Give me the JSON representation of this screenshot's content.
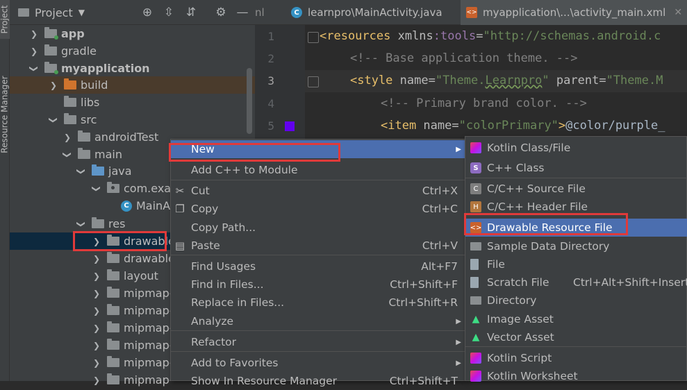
{
  "toolstrip": {
    "project_tab": "Project",
    "resource_manager_tab": "Resource Manager"
  },
  "project_panel": {
    "title": "Project",
    "toolbar_icons": [
      "locate-icon",
      "expand-all-icon",
      "collapse-all-icon",
      "gear-icon",
      "minimize-icon"
    ]
  },
  "tree": [
    {
      "label": "app",
      "bold": true,
      "arrow": "right",
      "icon": "module-folder"
    },
    {
      "label": "gradle",
      "arrow": "right",
      "icon": "folder"
    },
    {
      "label": "myapplication",
      "bold": true,
      "arrow": "down",
      "icon": "module-folder"
    },
    {
      "label": "build",
      "arrow": "right",
      "icon": "excluded-folder"
    },
    {
      "label": "libs",
      "arrow": "",
      "icon": "folder"
    },
    {
      "label": "src",
      "arrow": "down",
      "icon": "folder"
    },
    {
      "label": "androidTest",
      "arrow": "right",
      "icon": "folder"
    },
    {
      "label": "main",
      "arrow": "down",
      "icon": "folder"
    },
    {
      "label": "java",
      "arrow": "down",
      "icon": "source-folder"
    },
    {
      "label": "com.exa",
      "arrow": "down",
      "icon": "package"
    },
    {
      "label": "MainA",
      "arrow": "",
      "icon": "class"
    },
    {
      "label": "res",
      "arrow": "down",
      "icon": "resource-folder"
    },
    {
      "label": "drawable",
      "arrow": "right",
      "icon": "folder"
    },
    {
      "label": "drawable",
      "arrow": "right",
      "icon": "folder"
    },
    {
      "label": "layout",
      "arrow": "right",
      "icon": "folder"
    },
    {
      "label": "mipmap-",
      "arrow": "right",
      "icon": "folder"
    },
    {
      "label": "mipmap-",
      "arrow": "right",
      "icon": "folder"
    },
    {
      "label": "mipmap-",
      "arrow": "right",
      "icon": "folder"
    },
    {
      "label": "mipmap-",
      "arrow": "right",
      "icon": "folder"
    },
    {
      "label": "mipmap-",
      "arrow": "right",
      "icon": "folder"
    },
    {
      "label": "mipmap-",
      "arrow": "right",
      "icon": "folder"
    }
  ],
  "editor_tabs": [
    {
      "label": "nl",
      "icon": ""
    },
    {
      "label": "learnpro\\MainActivity.java",
      "icon": "C"
    },
    {
      "label": "myapplication\\...\\activity_main.xml",
      "icon": "xml"
    }
  ],
  "editor": {
    "line_numbers": [
      "1",
      "2",
      "3",
      "4",
      "5"
    ],
    "line1": {
      "open": "<resources",
      "attr": " xmlns",
      "ns": ":tools",
      "eq": "=",
      "val": "\"http://schemas.android.c"
    },
    "line2": {
      "comment": "<!-- Base application theme. -->"
    },
    "line3": {
      "open": "<style",
      "attr1": " name",
      "eq1": "=",
      "val1a": "\"Theme.",
      "val1b": "Learnpro",
      "val1c": "\"",
      "attr2": " parent",
      "eq2": "=",
      "val2": "\"Theme.M"
    },
    "line4": {
      "comment": "<!-- Primary brand color. -->"
    },
    "line5": {
      "open": "<item",
      "attr": " name",
      "eq": "=",
      "val": "\"colorPrimary\"",
      "close": ">",
      "text": "@color/purple_"
    },
    "swatch_color": "#6200ee"
  },
  "context_menu": {
    "items": [
      {
        "label": "New",
        "shortcut": "",
        "submenu": true,
        "icon": ""
      },
      {
        "label": "Add C++ to Module",
        "shortcut": "",
        "submenu": false,
        "icon": ""
      },
      {
        "label": "Cut",
        "shortcut": "Ctrl+X",
        "submenu": false,
        "icon": "scissors-icon"
      },
      {
        "label": "Copy",
        "shortcut": "Ctrl+C",
        "submenu": false,
        "icon": "copy-icon"
      },
      {
        "label": "Copy Path...",
        "shortcut": "",
        "submenu": false,
        "icon": ""
      },
      {
        "label": "Paste",
        "shortcut": "Ctrl+V",
        "submenu": false,
        "icon": "paste-icon"
      },
      {
        "label": "Find Usages",
        "shortcut": "Alt+F7",
        "submenu": false,
        "icon": ""
      },
      {
        "label": "Find in Files...",
        "shortcut": "Ctrl+Shift+F",
        "submenu": false,
        "icon": ""
      },
      {
        "label": "Replace in Files...",
        "shortcut": "Ctrl+Shift+R",
        "submenu": false,
        "icon": ""
      },
      {
        "label": "Analyze",
        "shortcut": "",
        "submenu": true,
        "icon": ""
      },
      {
        "label": "Refactor",
        "shortcut": "",
        "submenu": true,
        "icon": ""
      },
      {
        "label": "Add to Favorites",
        "shortcut": "",
        "submenu": true,
        "icon": ""
      },
      {
        "label": "Show In Resource Manager",
        "shortcut": "Ctrl+Shift+T",
        "submenu": false,
        "icon": ""
      }
    ]
  },
  "submenu": {
    "items": [
      {
        "label": "Kotlin Class/File",
        "shortcut": "",
        "icon": "kotlin-icon"
      },
      {
        "label": "C++ Class",
        "shortcut": "",
        "icon": "s-class-icon"
      },
      {
        "label": "C/C++ Source File",
        "shortcut": "",
        "icon": "cpp-source-icon"
      },
      {
        "label": "C/C++ Header File",
        "shortcut": "",
        "icon": "cpp-header-icon"
      },
      {
        "label": "Drawable Resource File",
        "shortcut": "",
        "icon": "drawable-icon"
      },
      {
        "label": "Sample Data Directory",
        "shortcut": "",
        "icon": "folder-icon"
      },
      {
        "label": "File",
        "shortcut": "",
        "icon": "file-icon"
      },
      {
        "label": "Scratch File",
        "shortcut": "Ctrl+Alt+Shift+Insert",
        "icon": "scratch-icon"
      },
      {
        "label": "Directory",
        "shortcut": "",
        "icon": "folder-icon"
      },
      {
        "label": "Image Asset",
        "shortcut": "",
        "icon": "android-icon"
      },
      {
        "label": "Vector Asset",
        "shortcut": "",
        "icon": "android-icon"
      },
      {
        "label": "Kotlin Script",
        "shortcut": "",
        "icon": "kotlin-icon"
      },
      {
        "label": "Kotlin Worksheet",
        "shortcut": "",
        "icon": "kotlin-icon"
      }
    ]
  },
  "colors": {
    "menu_highlight": "#4b6eaf",
    "annotation_red": "#e03a3a",
    "selection_row": "#0d293e",
    "excluded_row": "#4a3b2c"
  }
}
